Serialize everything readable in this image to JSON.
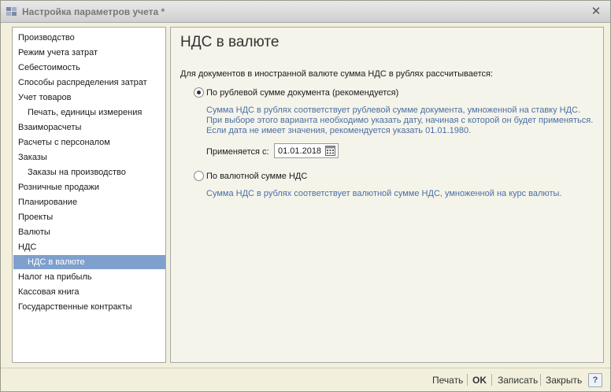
{
  "window": {
    "title": "Настройка параметров учета *",
    "close_symbol": "✕"
  },
  "sidebar": {
    "items": [
      {
        "label": "Производство",
        "level": 0,
        "active": false
      },
      {
        "label": "Режим учета затрат",
        "level": 0,
        "active": false
      },
      {
        "label": "Себестоимость",
        "level": 0,
        "active": false
      },
      {
        "label": "Способы распределения затрат",
        "level": 0,
        "active": false
      },
      {
        "label": "Учет товаров",
        "level": 0,
        "active": false
      },
      {
        "label": "Печать, единицы измерения",
        "level": 1,
        "active": false
      },
      {
        "label": "Взаиморасчеты",
        "level": 0,
        "active": false
      },
      {
        "label": "Расчеты с персоналом",
        "level": 0,
        "active": false
      },
      {
        "label": "Заказы",
        "level": 0,
        "active": false
      },
      {
        "label": "Заказы на производство",
        "level": 1,
        "active": false
      },
      {
        "label": "Розничные продажи",
        "level": 0,
        "active": false
      },
      {
        "label": "Планирование",
        "level": 0,
        "active": false
      },
      {
        "label": "Проекты",
        "level": 0,
        "active": false
      },
      {
        "label": "Валюты",
        "level": 0,
        "active": false
      },
      {
        "label": "НДС",
        "level": 0,
        "active": false
      },
      {
        "label": "НДС в валюте",
        "level": 1,
        "active": true
      },
      {
        "label": "Налог на прибыль",
        "level": 0,
        "active": false
      },
      {
        "label": "Кассовая книга",
        "level": 0,
        "active": false
      },
      {
        "label": "Государственные контракты",
        "level": 0,
        "active": false
      }
    ]
  },
  "main": {
    "title": "НДС в валюте",
    "intro": "Для документов в иностранной валюте сумма НДС в рублях рассчитывается:",
    "option1": {
      "label": "По рублевой сумме документа (рекомендуется)",
      "checked": true,
      "hint_lines": [
        "Сумма НДС в рублях соответствует рублевой сумме документа, умноженной на ставку НДС.",
        "При выборе этого варианта необходимо указать дату, начиная с которой он будет применяться.",
        "Если дата не имеет значения, рекомендуется указать 01.01.1980."
      ]
    },
    "date_label": "Применяется с:",
    "date_value": "01.01.2018",
    "option2": {
      "label": "По валютной сумме НДС",
      "checked": false,
      "hint_lines": [
        "Сумма НДС в рублях соответствует валютной сумме НДС, умноженной на курс валюты."
      ]
    }
  },
  "footer": {
    "print_label": "Печать",
    "ok_label": "OK",
    "save_label": "Записать",
    "close_label": "Закрыть",
    "help_label": "?"
  },
  "colors": {
    "active_item_bg": "#7fa0cc",
    "hint_text": "#4a6fa5",
    "window_bg": "#f2f0dc"
  },
  "icons": {
    "app": "app-grid-icon",
    "calendar": "calendar-icon",
    "help": "help-icon"
  }
}
